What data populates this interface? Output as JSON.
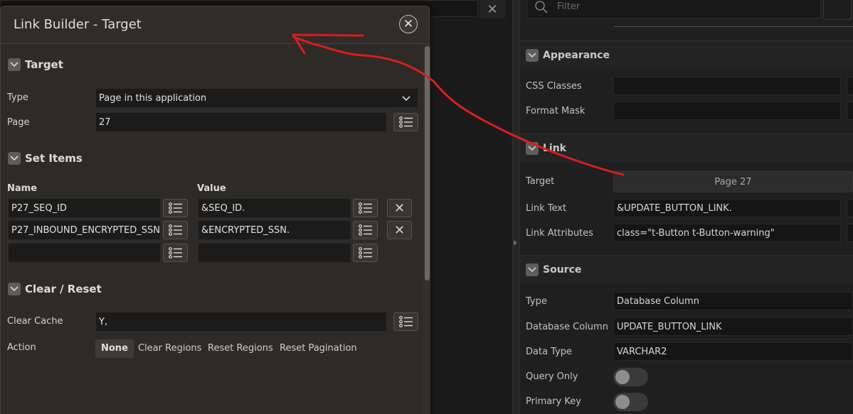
{
  "background": {
    "top_close_glyph": "✕"
  },
  "property_editor": {
    "filter_placeholder": "Filter",
    "sections": {
      "appearance": {
        "title": "Appearance",
        "css_classes_label": "CSS Classes",
        "css_classes_value": "",
        "format_mask_label": "Format Mask",
        "format_mask_value": ""
      },
      "link": {
        "title": "Link",
        "target_label": "Target",
        "target_value": "Page 27",
        "link_text_label": "Link Text",
        "link_text_value": "&UPDATE_BUTTON_LINK.",
        "link_attributes_label": "Link Attributes",
        "link_attributes_value": "class=\"t-Button t-Button-warning\""
      },
      "source": {
        "title": "Source",
        "type_label": "Type",
        "type_value": "Database Column",
        "db_column_label": "Database Column",
        "db_column_value": "UPDATE_BUTTON_LINK",
        "data_type_label": "Data Type",
        "data_type_value": "VARCHAR2",
        "query_only_label": "Query Only",
        "query_only_on": false,
        "primary_key_label": "Primary Key",
        "primary_key_on": false
      }
    }
  },
  "dialog": {
    "title": "Link Builder - Target",
    "target_section": {
      "title": "Target",
      "type_label": "Type",
      "type_value": "Page in this application",
      "page_label": "Page",
      "page_value": "27"
    },
    "set_items_section": {
      "title": "Set Items",
      "name_header": "Name",
      "value_header": "Value",
      "rows": [
        {
          "name": "P27_SEQ_ID",
          "value": "&SEQ_ID.",
          "deletable": true
        },
        {
          "name": "P27_INBOUND_ENCRYPTED_SSN",
          "value": "&ENCRYPTED_SSN.",
          "deletable": true
        },
        {
          "name": "",
          "value": "",
          "deletable": false
        }
      ]
    },
    "clear_reset_section": {
      "title": "Clear / Reset",
      "clear_cache_label": "Clear Cache",
      "clear_cache_value": "Y,",
      "action_label": "Action",
      "actions": [
        "None",
        "Clear Regions",
        "Reset Regions",
        "Reset Pagination"
      ],
      "selected_action": "None"
    }
  },
  "colors": {
    "annotation_arrow": "#d81e1e",
    "dialog_bg": "#2e2a27",
    "panel_bg": "#1f1f1f"
  }
}
